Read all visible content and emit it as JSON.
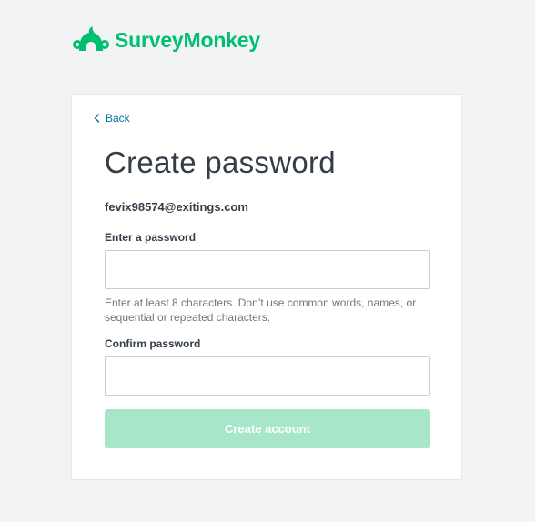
{
  "brand": {
    "name": "SurveyMonkey",
    "color": "#00bf6f",
    "logo_icon": "surveymonkey-logo-icon"
  },
  "nav": {
    "back_label": "Back",
    "back_icon": "chevron-left-icon"
  },
  "form": {
    "title": "Create password",
    "email": "fevix98574@exitings.com",
    "password_label": "Enter a password",
    "password_value": "",
    "password_hint": "Enter at least 8 characters. Don’t use common words, names, or sequential or repeated characters.",
    "confirm_label": "Confirm password",
    "confirm_value": "",
    "submit_label": "Create account",
    "submit_disabled": true
  },
  "colors": {
    "link": "#00739e",
    "text": "#333e48",
    "hint": "#6b787f",
    "button_disabled_bg": "#a8e6c9"
  }
}
